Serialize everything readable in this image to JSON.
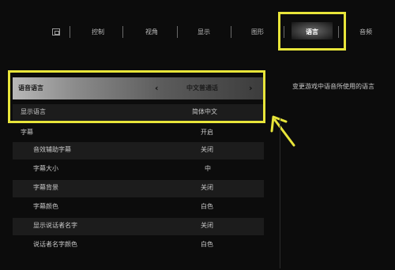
{
  "tabs": {
    "controls": "控制",
    "camera": "视角",
    "display": "显示",
    "graphics": "图形",
    "language": "语言",
    "audio": "音频"
  },
  "icons": {
    "left_tab_icon": "bumper-icon",
    "chevron_left": "‹",
    "chevron_right": "›"
  },
  "settings": [
    {
      "label": "语音语言",
      "value": "中文普通话"
    },
    {
      "label": "显示语言",
      "value": "简体中文"
    },
    {
      "label": "字幕",
      "value": "开启"
    },
    {
      "label": "音效辅助字幕",
      "value": "关闭"
    },
    {
      "label": "字幕大小",
      "value": "中"
    },
    {
      "label": "字幕背景",
      "value": "关闭"
    },
    {
      "label": "字幕颜色",
      "value": "白色"
    },
    {
      "label": "显示说话者名字",
      "value": "关闭"
    },
    {
      "label": "说话者名字颜色",
      "value": "白色"
    }
  ],
  "description": "变更游戏中语音所使用的语言",
  "colors": {
    "highlight": "#e8e53a",
    "background": "#0c0c0c"
  }
}
